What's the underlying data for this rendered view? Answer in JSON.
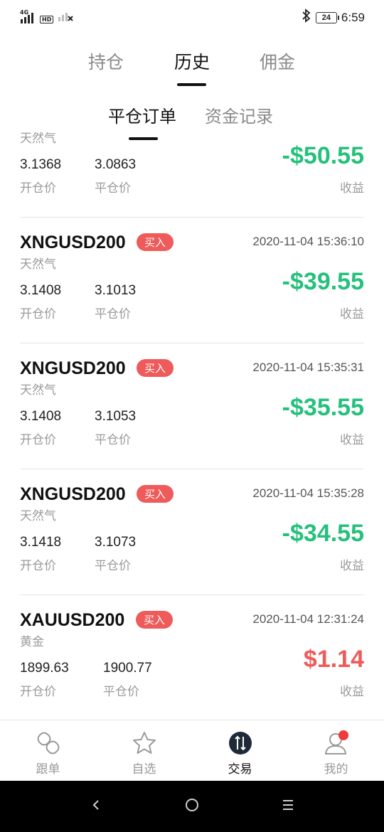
{
  "status_bar": {
    "network": "4G",
    "hd": "HD",
    "battery": "24",
    "time": "6:59",
    "icons": [
      "signal-icon",
      "hd-icon",
      "signal-none-icon",
      "bluetooth-icon",
      "battery-icon"
    ]
  },
  "main_tabs": [
    {
      "label": "持仓",
      "active": false
    },
    {
      "label": "历史",
      "active": true
    },
    {
      "label": "佣金",
      "active": false
    }
  ],
  "sub_tabs": [
    {
      "label": "平仓订单",
      "active": true
    },
    {
      "label": "资金记录",
      "active": false
    }
  ],
  "orders": [
    {
      "symbol": "",
      "side": "",
      "time": "",
      "name": "天然气",
      "open_price": "3.1368",
      "close_price": "3.0863",
      "open_label": "开仓价",
      "close_label": "平仓价",
      "pnl": "-$50.55",
      "pnl_label": "收益",
      "pnl_color": "#25c17c"
    },
    {
      "symbol": "XNGUSD200",
      "side": "买入",
      "time": "2020-11-04 15:36:10",
      "name": "天然气",
      "open_price": "3.1408",
      "close_price": "3.1013",
      "open_label": "开仓价",
      "close_label": "平仓价",
      "pnl": "-$39.55",
      "pnl_label": "收益",
      "pnl_color": "#25c17c"
    },
    {
      "symbol": "XNGUSD200",
      "side": "买入",
      "time": "2020-11-04 15:35:31",
      "name": "天然气",
      "open_price": "3.1408",
      "close_price": "3.1053",
      "open_label": "开仓价",
      "close_label": "平仓价",
      "pnl": "-$35.55",
      "pnl_label": "收益",
      "pnl_color": "#25c17c"
    },
    {
      "symbol": "XNGUSD200",
      "side": "买入",
      "time": "2020-11-04 15:35:28",
      "name": "天然气",
      "open_price": "3.1418",
      "close_price": "3.1073",
      "open_label": "开仓价",
      "close_label": "平仓价",
      "pnl": "-$34.55",
      "pnl_label": "收益",
      "pnl_color": "#25c17c"
    },
    {
      "symbol": "XAUUSD200",
      "side": "买入",
      "time": "2020-11-04 12:31:24",
      "name": "黄金",
      "open_price": "1899.63",
      "close_price": "1900.77",
      "open_label": "开仓价",
      "close_label": "平仓价",
      "pnl": "$1.14",
      "pnl_label": "收益",
      "pnl_color": "#ef5a5a"
    }
  ],
  "bottom_nav": [
    {
      "label": "跟单",
      "icon": "link-icon",
      "active": false
    },
    {
      "label": "自选",
      "icon": "star-icon",
      "active": false
    },
    {
      "label": "交易",
      "icon": "trade-icon",
      "active": true
    },
    {
      "label": "我的",
      "icon": "profile-icon",
      "active": false
    }
  ],
  "colors": {
    "gain": "#ef5a5a",
    "loss": "#25c17c",
    "badge": "#ef5a5a",
    "notification_dot": "#ef3b3b"
  }
}
